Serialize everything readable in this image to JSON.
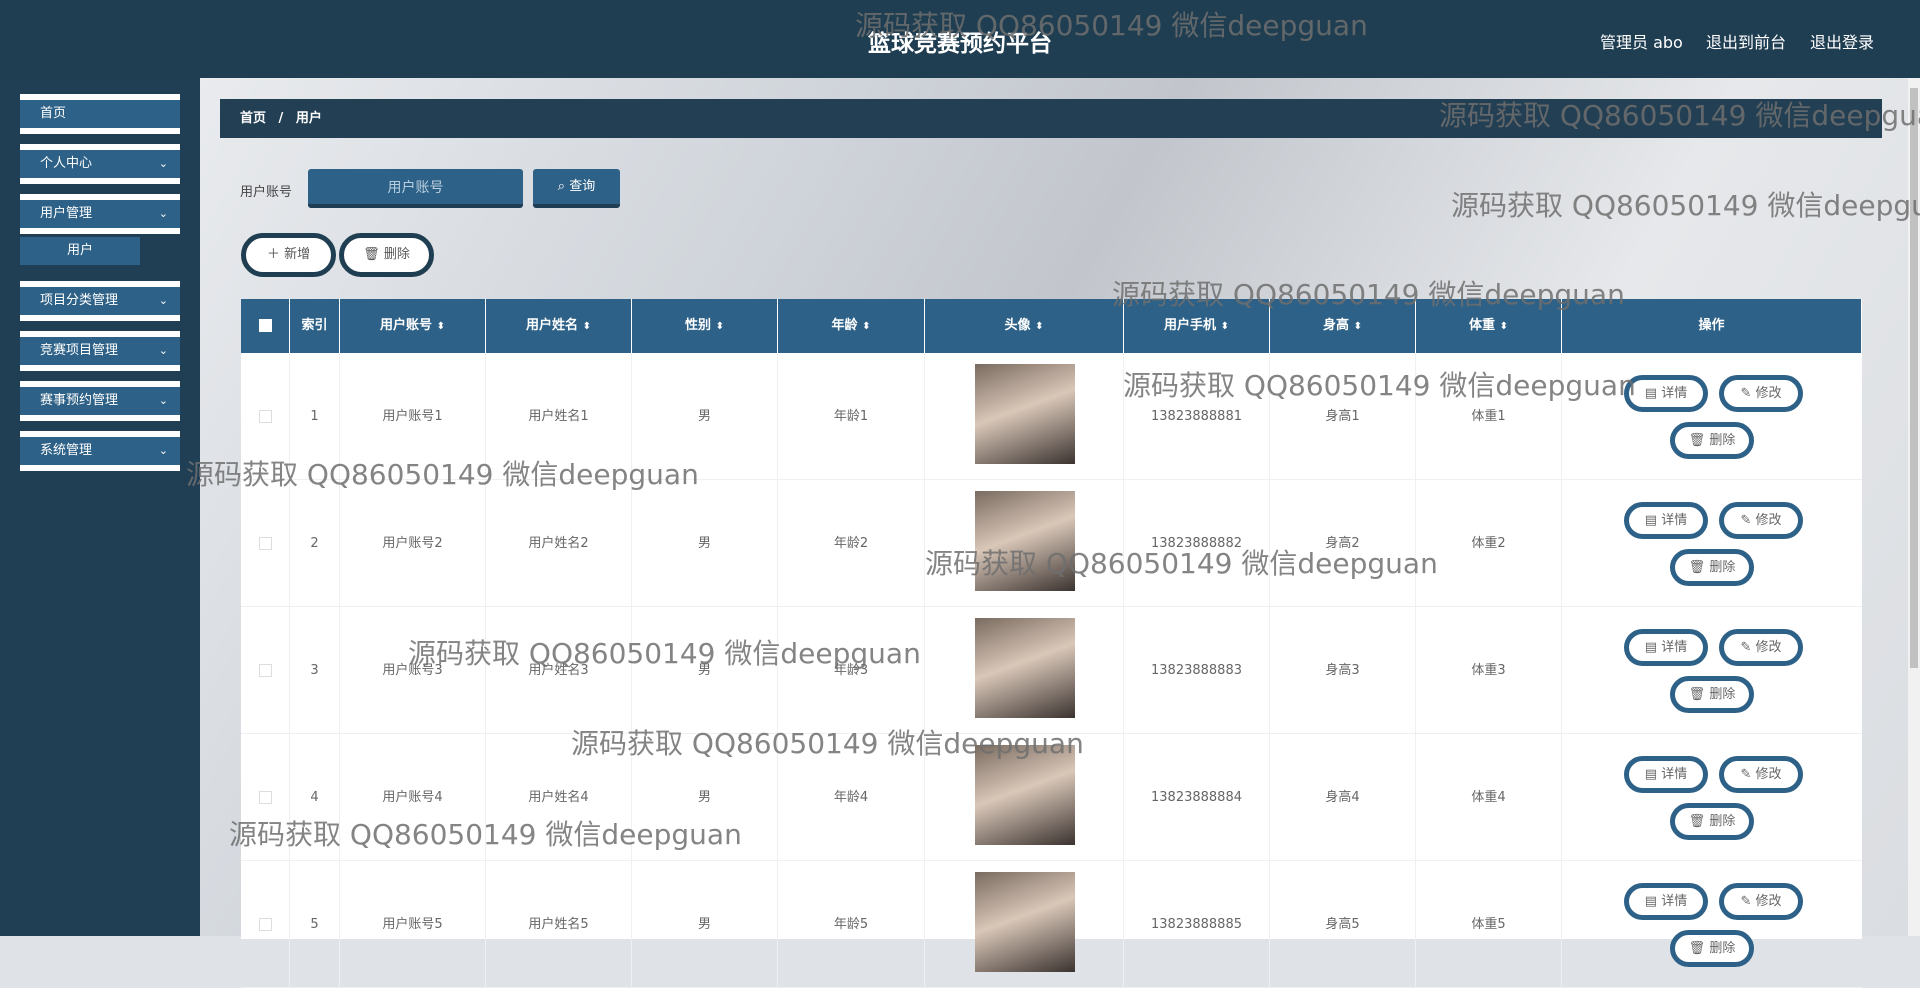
{
  "header": {
    "title": "篮球竞赛预约平台",
    "user": "管理员 abo",
    "to_front": "退出到前台",
    "logout": "退出登录"
  },
  "sidebar": {
    "items": [
      {
        "label": "首页",
        "expandable": false
      },
      {
        "label": "个人中心",
        "expandable": true
      },
      {
        "label": "用户管理",
        "expandable": true
      },
      {
        "label": "项目分类管理",
        "expandable": true
      },
      {
        "label": "竞赛项目管理",
        "expandable": true
      },
      {
        "label": "赛事预约管理",
        "expandable": true
      },
      {
        "label": "系统管理",
        "expandable": true
      }
    ],
    "sub_item": "用户"
  },
  "breadcrumb": {
    "home": "首页",
    "sep": "/",
    "current": "用户"
  },
  "search": {
    "label": "用户账号",
    "placeholder": "用户账号",
    "button": "查询"
  },
  "actions": {
    "add": "新增",
    "delete": "删除"
  },
  "table": {
    "columns": [
      "索引",
      "用户账号",
      "用户姓名",
      "性别",
      "年龄",
      "头像",
      "用户手机",
      "身高",
      "体重",
      "操作"
    ],
    "sortable": [
      false,
      true,
      true,
      true,
      true,
      true,
      true,
      true,
      true,
      false
    ],
    "rows": [
      {
        "index": "1",
        "account": "用户账号1",
        "name": "用户姓名1",
        "gender": "男",
        "age": "年龄1",
        "phone": "13823888881",
        "height": "身高1",
        "weight": "体重1"
      },
      {
        "index": "2",
        "account": "用户账号2",
        "name": "用户姓名2",
        "gender": "男",
        "age": "年龄2",
        "phone": "13823888882",
        "height": "身高2",
        "weight": "体重2"
      },
      {
        "index": "3",
        "account": "用户账号3",
        "name": "用户姓名3",
        "gender": "男",
        "age": "年龄3",
        "phone": "13823888883",
        "height": "身高3",
        "weight": "体重3"
      },
      {
        "index": "4",
        "account": "用户账号4",
        "name": "用户姓名4",
        "gender": "男",
        "age": "年龄4",
        "phone": "13823888884",
        "height": "身高4",
        "weight": "体重4"
      },
      {
        "index": "5",
        "account": "用户账号5",
        "name": "用户姓名5",
        "gender": "男",
        "age": "年龄5",
        "phone": "13823888885",
        "height": "身高5",
        "weight": "体重5"
      }
    ],
    "row_actions": {
      "detail": "详情",
      "edit": "修改",
      "delete": "删除"
    }
  },
  "watermark": "源码获取 QQ86050149 微信deepguan",
  "colors": {
    "header": "#1f3e52",
    "primary": "#2d6187",
    "sidebar": "#203e54"
  }
}
